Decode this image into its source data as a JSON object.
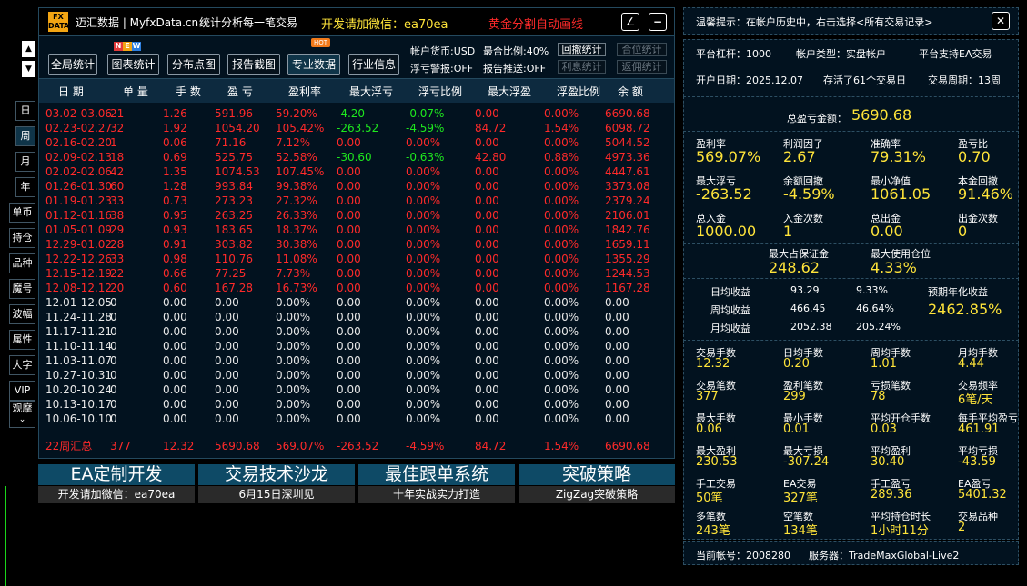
{
  "app": {
    "logo_top": "FX",
    "logo_bottom": "DATA",
    "title": "迈汇数据 | MyfxData.cn",
    "subtitle": "统计分析每一笔交易",
    "contact": "开发请加微信：ea70ea",
    "promo": "黄金分割自动画线",
    "edit_icon": "∠",
    "minimize_icon": "−"
  },
  "badges": {
    "new": [
      "N",
      "E",
      "W"
    ],
    "hot": "HOT"
  },
  "toolbar": {
    "buttons": [
      "全局统计",
      "图表统计",
      "分布点图",
      "报告截图",
      "专业数据",
      "行业信息"
    ],
    "account_currency": "帐户货币:USD",
    "max_ratio": "最合比例:40%",
    "float_alert": "浮亏警报:OFF",
    "report_push": "报告推送:OFF",
    "small_buttons": [
      "回撤统计",
      "合位统计",
      "利息统计",
      "返佣统计"
    ]
  },
  "table": {
    "headers": [
      "日 期",
      "单 量",
      "手 数",
      "盈 亏",
      "盈利率",
      "最大浮亏",
      "浮亏比例",
      "最大浮盈",
      "浮盈比例",
      "余 额"
    ],
    "rows": [
      {
        "c": "red",
        "v": [
          "03.02-03.06",
          "21",
          "1.26",
          "591.96",
          "59.20%",
          "-4.20",
          "-0.07%",
          "0.00",
          "0.00%",
          "6690.68"
        ],
        "g": [
          5,
          6
        ]
      },
      {
        "c": "red",
        "v": [
          "02.23-02.27",
          "32",
          "1.92",
          "1054.20",
          "105.42%",
          "-263.52",
          "-4.59%",
          "84.72",
          "1.54%",
          "6098.72"
        ],
        "g": [
          5,
          6
        ]
      },
      {
        "c": "red",
        "v": [
          "02.16-02.20",
          "1",
          "0.06",
          "71.16",
          "7.12%",
          "0.00",
          "0.00%",
          "0.00",
          "0.00%",
          "5044.52"
        ],
        "g": []
      },
      {
        "c": "red",
        "v": [
          "02.09-02.13",
          "18",
          "0.69",
          "525.75",
          "52.58%",
          "-30.60",
          "-0.63%",
          "42.80",
          "0.88%",
          "4973.36"
        ],
        "g": [
          5,
          6
        ]
      },
      {
        "c": "red",
        "v": [
          "02.02-02.06",
          "42",
          "1.35",
          "1074.53",
          "107.45%",
          "0.00",
          "0.00%",
          "0.00",
          "0.00%",
          "4447.61"
        ],
        "g": []
      },
      {
        "c": "red",
        "v": [
          "01.26-01.30",
          "60",
          "1.28",
          "993.84",
          "99.38%",
          "0.00",
          "0.00%",
          "0.00",
          "0.00%",
          "3373.08"
        ],
        "g": []
      },
      {
        "c": "red",
        "v": [
          "01.19-01.23",
          "33",
          "0.73",
          "273.23",
          "27.32%",
          "0.00",
          "0.00%",
          "0.00",
          "0.00%",
          "2379.24"
        ],
        "g": []
      },
      {
        "c": "red",
        "v": [
          "01.12-01.16",
          "38",
          "0.95",
          "263.25",
          "26.33%",
          "0.00",
          "0.00%",
          "0.00",
          "0.00%",
          "2106.01"
        ],
        "g": []
      },
      {
        "c": "red",
        "v": [
          "01.05-01.09",
          "29",
          "0.93",
          "183.65",
          "18.37%",
          "0.00",
          "0.00%",
          "0.00",
          "0.00%",
          "1842.76"
        ],
        "g": []
      },
      {
        "c": "red",
        "v": [
          "12.29-01.02",
          "28",
          "0.91",
          "303.82",
          "30.38%",
          "0.00",
          "0.00%",
          "0.00",
          "0.00%",
          "1659.11"
        ],
        "g": []
      },
      {
        "c": "red",
        "v": [
          "12.22-12.26",
          "33",
          "0.98",
          "110.76",
          "11.08%",
          "0.00",
          "0.00%",
          "0.00",
          "0.00%",
          "1355.29"
        ],
        "g": []
      },
      {
        "c": "red",
        "v": [
          "12.15-12.19",
          "22",
          "0.66",
          "77.25",
          "7.73%",
          "0.00",
          "0.00%",
          "0.00",
          "0.00%",
          "1244.53"
        ],
        "g": []
      },
      {
        "c": "red",
        "v": [
          "12.08-12.12",
          "20",
          "0.60",
          "167.28",
          "16.73%",
          "0.00",
          "0.00%",
          "0.00",
          "0.00%",
          "1167.28"
        ],
        "g": []
      },
      {
        "c": "wht",
        "v": [
          "12.01-12.05",
          "0",
          "0.00",
          "0.00",
          "0.00%",
          "0.00",
          "0.00%",
          "0.00",
          "0.00%",
          "0.00"
        ],
        "g": []
      },
      {
        "c": "wht",
        "v": [
          "11.24-11.28",
          "0",
          "0.00",
          "0.00",
          "0.00%",
          "0.00",
          "0.00%",
          "0.00",
          "0.00%",
          "0.00"
        ],
        "g": []
      },
      {
        "c": "wht",
        "v": [
          "11.17-11.21",
          "0",
          "0.00",
          "0.00",
          "0.00%",
          "0.00",
          "0.00%",
          "0.00",
          "0.00%",
          "0.00"
        ],
        "g": []
      },
      {
        "c": "wht",
        "v": [
          "11.10-11.14",
          "0",
          "0.00",
          "0.00",
          "0.00%",
          "0.00",
          "0.00%",
          "0.00",
          "0.00%",
          "0.00"
        ],
        "g": []
      },
      {
        "c": "wht",
        "v": [
          "11.03-11.07",
          "0",
          "0.00",
          "0.00",
          "0.00%",
          "0.00",
          "0.00%",
          "0.00",
          "0.00%",
          "0.00"
        ],
        "g": []
      },
      {
        "c": "wht",
        "v": [
          "10.27-10.31",
          "0",
          "0.00",
          "0.00",
          "0.00%",
          "0.00",
          "0.00%",
          "0.00",
          "0.00%",
          "0.00"
        ],
        "g": []
      },
      {
        "c": "wht",
        "v": [
          "10.20-10.24",
          "0",
          "0.00",
          "0.00",
          "0.00%",
          "0.00",
          "0.00%",
          "0.00",
          "0.00%",
          "0.00"
        ],
        "g": []
      },
      {
        "c": "wht",
        "v": [
          "10.13-10.17",
          "0",
          "0.00",
          "0.00",
          "0.00%",
          "0.00",
          "0.00%",
          "0.00",
          "0.00%",
          "0.00"
        ],
        "g": []
      },
      {
        "c": "wht",
        "v": [
          "10.06-10.10",
          "0",
          "0.00",
          "0.00",
          "0.00%",
          "0.00",
          "0.00%",
          "0.00",
          "0.00%",
          "0.00"
        ],
        "g": []
      }
    ],
    "summary": [
      "22周汇总",
      "377",
      "12.32",
      "5690.68",
      "569.07%",
      "-263.52",
      "-4.59%",
      "84.72",
      "1.54%",
      "6690.68"
    ]
  },
  "sidebar": {
    "up": "▲",
    "down": "▼",
    "periods": [
      "日",
      "周",
      "月",
      "年"
    ],
    "filters": [
      "单币",
      "持仓",
      "品种",
      "魔号",
      "波幅",
      "属性",
      "大字",
      "VIP"
    ],
    "more": "观摩",
    "more_arrow": "⌄"
  },
  "banners": [
    {
      "title": "EA定制开发",
      "sub": "开发请加微信：ea70ea"
    },
    {
      "title": "交易技术沙龙",
      "sub": "6月15日深圳见"
    },
    {
      "title": "最佳跟单系统",
      "sub": "十年实战实力打造"
    },
    {
      "title": "突破策略",
      "sub": "ZigZag突破策略"
    }
  ],
  "right": {
    "tip": "温馨提示：在帐户历史中，右击选择<所有交易记录>",
    "close": "✕",
    "info1": [
      "平台杠杆：1000",
      "帐户类型：实盘帐户",
      "平台支持EA交易"
    ],
    "info2": [
      "开户日期：2025.12.07",
      "存活了61个交易日",
      "交易周期：13周"
    ],
    "total_label": "总盈亏金额：",
    "total_value": "5690.68",
    "g1": [
      {
        "l": "盈利率",
        "v": "569.07%"
      },
      {
        "l": "利润因子",
        "v": "2.67"
      },
      {
        "l": "准确率",
        "v": "79.31%"
      },
      {
        "l": "盈亏比",
        "v": "0.70"
      },
      {
        "l": "最大浮亏",
        "v": "-263.52"
      },
      {
        "l": "余额回撤",
        "v": "-4.59%"
      },
      {
        "l": "最小净值",
        "v": "1061.05"
      },
      {
        "l": "本金回撤",
        "v": "91.46%"
      },
      {
        "l": "总入金",
        "v": "1000.00"
      },
      {
        "l": "入金次数",
        "v": "1"
      },
      {
        "l": "总出金",
        "v": "0.00"
      },
      {
        "l": "出金次数",
        "v": "0"
      }
    ],
    "margin": [
      {
        "l": "最大占保证金",
        "v": "248.62"
      },
      {
        "l": "最大使用仓位",
        "v": "4.33%"
      }
    ],
    "income": [
      {
        "l": "日均收益",
        "a": "93.29",
        "b": "9.33%"
      },
      {
        "l": "周均收益",
        "a": "466.45",
        "b": "46.64%"
      },
      {
        "l": "月均收益",
        "a": "2052.38",
        "b": "205.24%"
      }
    ],
    "annual_label": "预期年化收益",
    "annual_value": "2462.85%",
    "g2": [
      [
        {
          "l": "交易手数",
          "v": "12.32"
        },
        {
          "l": "日均手数",
          "v": "0.20"
        },
        {
          "l": "周均手数",
          "v": "1.01"
        },
        {
          "l": "月均手数",
          "v": "4.44"
        }
      ],
      [
        {
          "l": "交易笔数",
          "v": "377"
        },
        {
          "l": "盈利笔数",
          "v": "299"
        },
        {
          "l": "亏损笔数",
          "v": "78"
        },
        {
          "l": "交易频率",
          "v": "6笔/天"
        }
      ],
      [
        {
          "l": "最大手数",
          "v": "0.06"
        },
        {
          "l": "最小手数",
          "v": "0.01"
        },
        {
          "l": "平均开仓手数",
          "v": "0.03"
        },
        {
          "l": "每手平均盈亏",
          "v": "461.91"
        }
      ],
      [
        {
          "l": "最大盈利",
          "v": "230.53"
        },
        {
          "l": "最大亏损",
          "v": "-307.24"
        },
        {
          "l": "平均盈利",
          "v": "30.40"
        },
        {
          "l": "平均亏损",
          "v": "-43.59"
        }
      ],
      [
        {
          "l": "手工交易",
          "v": "50笔"
        },
        {
          "l": "EA交易",
          "v": "327笔"
        },
        {
          "l": "手工盈亏",
          "v": "289.36"
        },
        {
          "l": "EA盈亏",
          "v": "5401.32"
        }
      ],
      [
        {
          "l": "多笔数",
          "v": "243笔"
        },
        {
          "l": "空笔数",
          "v": "134笔"
        },
        {
          "l": "平均持仓时长",
          "v": "1小时11分"
        },
        {
          "l": "交易品种",
          "v": "2"
        }
      ]
    ],
    "footer": [
      "当前帐号：2008280",
      "服务器：TradeMaxGlobal-Live2"
    ]
  }
}
